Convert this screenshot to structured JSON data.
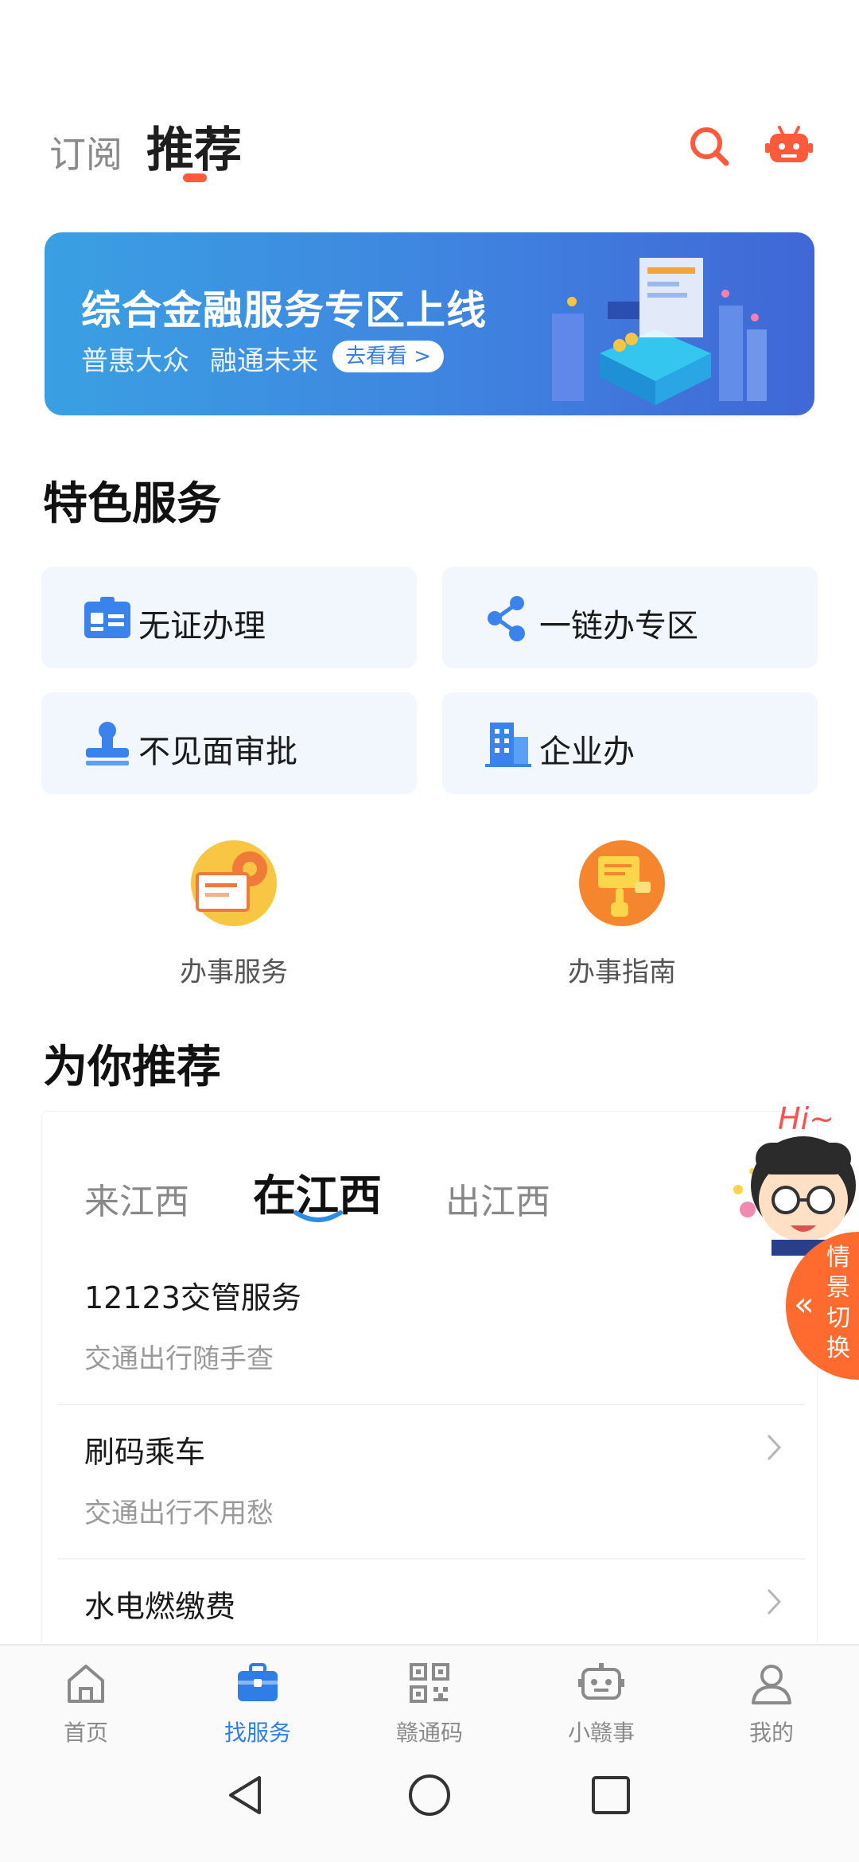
{
  "header": {
    "tab_subscribe": "订阅",
    "tab_recommend": "推荐",
    "search_icon": "search-icon",
    "robot_icon": "robot-icon",
    "accent": "#ff5a3c"
  },
  "banner": {
    "title": "综合金融服务专区上线",
    "subtitle_1": "普惠大众",
    "subtitle_2": "融通未来",
    "button": "去看看 >"
  },
  "featured": {
    "title": "特色服务",
    "cards": [
      {
        "label": "无证办理",
        "icon": "id-card-icon"
      },
      {
        "label": "一链办专区",
        "icon": "share-nodes-icon"
      },
      {
        "label": "不见面审批",
        "icon": "stamp-icon"
      },
      {
        "label": "企业办",
        "icon": "building-icon"
      }
    ],
    "services": [
      {
        "label": "办事服务",
        "icon": "service-gear-icon"
      },
      {
        "label": "办事指南",
        "icon": "guide-pointer-icon"
      }
    ]
  },
  "recommend": {
    "title": "为你推荐",
    "tabs": [
      "来江西",
      "在江西",
      "出江西"
    ],
    "active_tab": "在江西",
    "items": [
      {
        "title": "12123交管服务",
        "subtitle": "交通出行随手查"
      },
      {
        "title": "刷码乘车",
        "subtitle": "交通出行不用愁"
      },
      {
        "title": "水电燃缴费",
        "subtitle": ""
      }
    ]
  },
  "mascot": {
    "greeting": "Hi~",
    "switch_label": "情景切换"
  },
  "bottom_nav": {
    "active_color": "#2f7ee8",
    "items": [
      {
        "label": "首页",
        "icon": "home-icon"
      },
      {
        "label": "找服务",
        "icon": "briefcase-icon"
      },
      {
        "label": "赣通码",
        "icon": "qr-code-icon"
      },
      {
        "label": "小赣事",
        "icon": "bot-icon"
      },
      {
        "label": "我的",
        "icon": "user-icon"
      }
    ]
  }
}
